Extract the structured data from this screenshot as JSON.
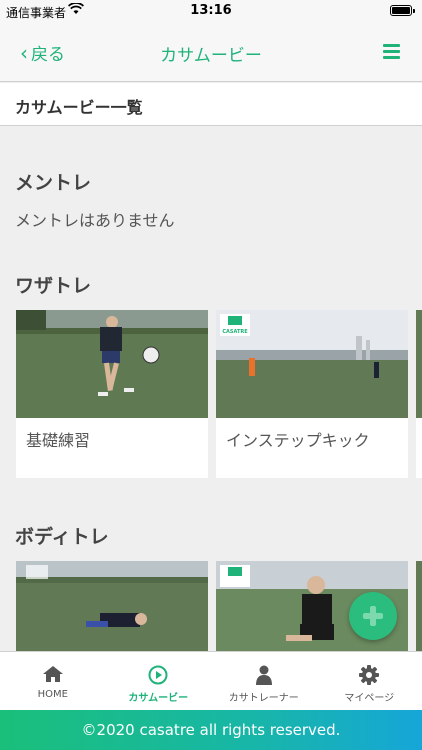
{
  "status_bar": {
    "carrier": "通信事業者",
    "time": "13:16"
  },
  "nav": {
    "back_label": "戻る",
    "title": "カサムービー"
  },
  "list_header": "カサムービー一覧",
  "sections": [
    {
      "title": "メントレ",
      "empty_message": "メントレはありません"
    },
    {
      "title": "ワザトレ",
      "cards": [
        {
          "label": "基礎練習"
        },
        {
          "label": "インステップキック"
        }
      ]
    },
    {
      "title": "ボディトレ"
    }
  ],
  "thumb_badge": "CASATRE",
  "tabs": [
    {
      "label": "HOME",
      "icon": "home-icon"
    },
    {
      "label": "カサムービー",
      "icon": "play-circle-icon",
      "active": true
    },
    {
      "label": "カサトレーナー",
      "icon": "person-icon"
    },
    {
      "label": "マイページ",
      "icon": "gear-icon"
    }
  ],
  "footer": "©2020 casatre all rights reserved.",
  "colors": {
    "accent": "#1fb37a",
    "background": "#efefef",
    "fab": "#2bbd7e"
  }
}
